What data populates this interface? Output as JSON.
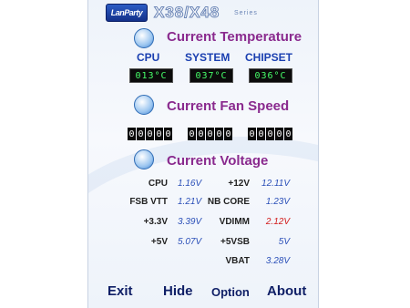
{
  "header": {
    "logo": "LanParty",
    "model": "X38/X48",
    "series": "Series"
  },
  "temperature": {
    "title": "Current Temperature",
    "icon": "sun-icon",
    "columns": [
      {
        "label": "CPU",
        "value": "013°C"
      },
      {
        "label": "SYSTEM",
        "value": "037°C"
      },
      {
        "label": "CHIPSET",
        "value": "036°C"
      }
    ]
  },
  "fan": {
    "title": "Current Fan Speed",
    "icon": "fan-icon",
    "readouts": [
      "00000",
      "00000",
      "00000"
    ]
  },
  "voltage": {
    "title": "Current Voltage",
    "icon": "lightning-icon",
    "rows": [
      {
        "l1": "CPU",
        "v1": "1.16V",
        "l2": "+12V",
        "v2": "12.11V"
      },
      {
        "l1": "FSB VTT",
        "v1": "1.21V",
        "l2": "NB CORE",
        "v2": "1.23V"
      },
      {
        "l1": "+3.3V",
        "v1": "3.39V",
        "l2": "VDIMM",
        "v2": "2.12V"
      },
      {
        "l1": "+5V",
        "v1": "5.07V",
        "l2": "+5VSB",
        "v2": "5V"
      },
      {
        "l1": "",
        "v1": "",
        "l2": "VBAT",
        "v2": "3.28V"
      }
    ],
    "alert_color": "#d21a1a",
    "value_color": "#2a4fb8"
  },
  "buttons": {
    "exit": "Exit",
    "hide": "Hide",
    "option": "Option",
    "about": "About"
  }
}
